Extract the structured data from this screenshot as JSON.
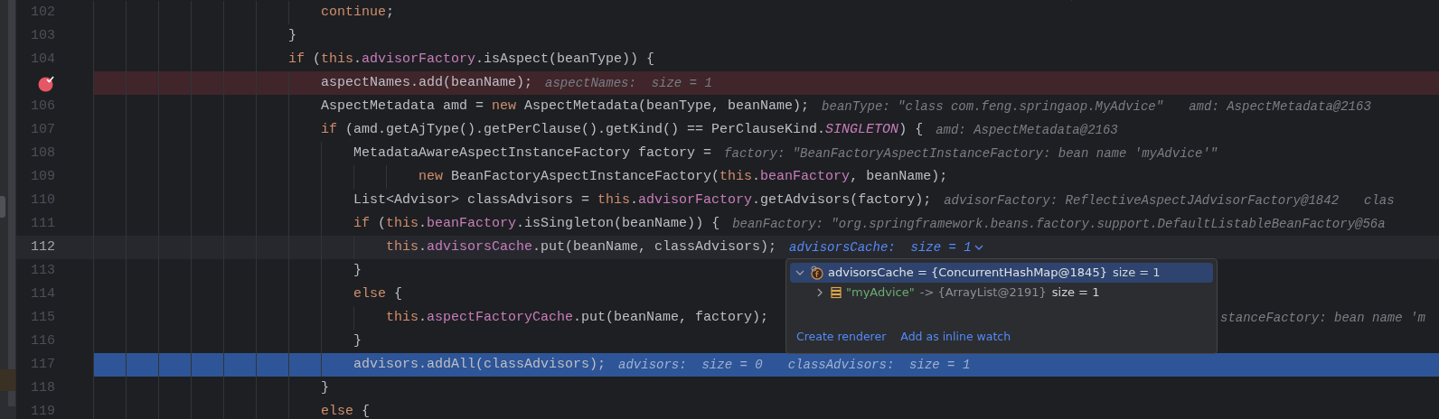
{
  "editor": {
    "lines": [
      {
        "number": "102",
        "breakpoint": false,
        "caret_line": false,
        "execution_point": false,
        "code": [
          {
            "kind": "keyword",
            "text": "                            continue"
          },
          {
            "kind": "plain",
            "text": ";"
          }
        ]
      },
      {
        "number": "103",
        "breakpoint": false,
        "caret_line": false,
        "execution_point": false,
        "code": [
          {
            "kind": "plain",
            "text": "                        }"
          }
        ]
      },
      {
        "number": "104",
        "breakpoint": false,
        "caret_line": false,
        "execution_point": false,
        "code": [
          {
            "kind": "keyword",
            "text": "                        if"
          },
          {
            "kind": "plain",
            "text": " ("
          },
          {
            "kind": "keyword",
            "text": "this"
          },
          {
            "kind": "plain",
            "text": "."
          },
          {
            "kind": "field",
            "text": "advisorFactory"
          },
          {
            "kind": "plain",
            "text": ".isAspect(beanType)) {"
          }
        ]
      },
      {
        "breakpoint": true,
        "caret_line": false,
        "execution_point": false,
        "code": [
          {
            "kind": "plain",
            "text": "                            aspectNames.add(beanName);"
          }
        ],
        "hints": [
          {
            "kind": "value",
            "text": "aspectNames:  size = 1"
          }
        ]
      },
      {
        "number": "106",
        "breakpoint": false,
        "caret_line": false,
        "execution_point": false,
        "code": [
          {
            "kind": "plain",
            "text": "                            AspectMetadata amd = "
          },
          {
            "kind": "keyword",
            "text": "new"
          },
          {
            "kind": "plain",
            "text": " AspectMetadata(beanType, beanName);"
          }
        ],
        "hints": [
          {
            "kind": "value",
            "text": "beanType: \"class com.feng.springaop.MyAdvice\""
          },
          {
            "kind": "value",
            "text": "amd: AspectMetadata@2163"
          }
        ]
      },
      {
        "number": "107",
        "breakpoint": false,
        "caret_line": false,
        "execution_point": false,
        "code": [
          {
            "kind": "keyword",
            "text": "                            if"
          },
          {
            "kind": "plain",
            "text": " (amd.getAjType().getPerClause().getKind() == PerClauseKind."
          },
          {
            "kind": "constant",
            "text": "SINGLETON"
          },
          {
            "kind": "plain",
            "text": ") {"
          }
        ],
        "hints": [
          {
            "kind": "value",
            "text": "amd: AspectMetadata@2163"
          }
        ]
      },
      {
        "number": "108",
        "breakpoint": false,
        "caret_line": false,
        "execution_point": false,
        "code": [
          {
            "kind": "plain",
            "text": "                                MetadataAwareAspectInstanceFactory factory ="
          }
        ],
        "hints": [
          {
            "kind": "value",
            "text": "factory: \"BeanFactoryAspectInstanceFactory: bean name 'myAdvice'\""
          }
        ]
      },
      {
        "number": "109",
        "breakpoint": false,
        "caret_line": false,
        "execution_point": false,
        "code": [
          {
            "kind": "keyword",
            "text": "                                        new"
          },
          {
            "kind": "plain",
            "text": " BeanFactoryAspectInstanceFactory("
          },
          {
            "kind": "keyword",
            "text": "this"
          },
          {
            "kind": "plain",
            "text": "."
          },
          {
            "kind": "field",
            "text": "beanFactory"
          },
          {
            "kind": "plain",
            "text": ", beanName);"
          }
        ]
      },
      {
        "number": "110",
        "breakpoint": false,
        "caret_line": false,
        "execution_point": false,
        "code": [
          {
            "kind": "plain",
            "text": "                                List<Advisor> classAdvisors = "
          },
          {
            "kind": "keyword",
            "text": "this"
          },
          {
            "kind": "plain",
            "text": "."
          },
          {
            "kind": "field",
            "text": "advisorFactory"
          },
          {
            "kind": "plain",
            "text": ".getAdvisors(factory);"
          }
        ],
        "hints": [
          {
            "kind": "value",
            "text": "advisorFactory: ReflectiveAspectJAdvisorFactory@1842"
          },
          {
            "kind": "value",
            "text": "clas"
          }
        ]
      },
      {
        "number": "111",
        "breakpoint": false,
        "caret_line": false,
        "execution_point": false,
        "code": [
          {
            "kind": "keyword",
            "text": "                                if"
          },
          {
            "kind": "plain",
            "text": " ("
          },
          {
            "kind": "keyword",
            "text": "this"
          },
          {
            "kind": "plain",
            "text": "."
          },
          {
            "kind": "field",
            "text": "beanFactory"
          },
          {
            "kind": "plain",
            "text": ".isSingleton(beanName)) {"
          }
        ],
        "hints": [
          {
            "kind": "value",
            "text": "beanFactory: \"org.springframework.beans.factory.support.DefaultListableBeanFactory@56a"
          }
        ]
      },
      {
        "number": "112",
        "breakpoint": false,
        "caret_line": true,
        "execution_point": false,
        "code": [
          {
            "kind": "keyword",
            "text": "                                    this"
          },
          {
            "kind": "plain",
            "text": "."
          },
          {
            "kind": "field",
            "text": "advisorsCache"
          },
          {
            "kind": "plain",
            "text": ".put(beanName, classAdvisors);"
          }
        ],
        "hints": [
          {
            "kind": "watch",
            "text": "advisorsCache:  size = 1"
          }
        ]
      },
      {
        "number": "113",
        "breakpoint": false,
        "caret_line": false,
        "execution_point": false,
        "code": [
          {
            "kind": "plain",
            "text": "                                }"
          }
        ]
      },
      {
        "number": "114",
        "breakpoint": false,
        "caret_line": false,
        "execution_point": false,
        "code": [
          {
            "kind": "keyword",
            "text": "                                else"
          },
          {
            "kind": "plain",
            "text": " {"
          }
        ]
      },
      {
        "number": "115",
        "breakpoint": false,
        "caret_line": false,
        "execution_point": false,
        "code": [
          {
            "kind": "keyword",
            "text": "                                    this"
          },
          {
            "kind": "plain",
            "text": "."
          },
          {
            "kind": "field",
            "text": "aspectFactoryCache"
          },
          {
            "kind": "plain",
            "text": ".put(beanName, factory);"
          }
        ],
        "hints": [
          {
            "kind": "behind_popup",
            "text": "stanceFactory: bean name 'm"
          }
        ]
      },
      {
        "number": "116",
        "breakpoint": false,
        "caret_line": false,
        "execution_point": false,
        "code": [
          {
            "kind": "plain",
            "text": "                                }"
          }
        ]
      },
      {
        "number": "117",
        "breakpoint": false,
        "caret_line": false,
        "execution_point": true,
        "code": [
          {
            "kind": "plain",
            "text": "                                advisors.addAll(classAdvisors);"
          }
        ],
        "hints": [
          {
            "kind": "value",
            "text": "advisors:  size = 0"
          },
          {
            "kind": "value",
            "text": "classAdvisors:  size = 1"
          }
        ]
      },
      {
        "number": "118",
        "breakpoint": false,
        "caret_line": false,
        "execution_point": false,
        "code": [
          {
            "kind": "plain",
            "text": "                            }"
          }
        ]
      },
      {
        "number": "119",
        "breakpoint": false,
        "caret_line": false,
        "execution_point": false,
        "code": [
          {
            "kind": "keyword",
            "text": "                            else"
          },
          {
            "kind": "plain",
            "text": " {"
          }
        ]
      }
    ]
  },
  "popup": {
    "tree": [
      {
        "kind": "map",
        "expanded": true,
        "selected": true,
        "parts": [
          {
            "kind": "name",
            "text": "advisorsCache = {ConcurrentHashMap@1845}"
          },
          {
            "kind": "plain",
            "text": "size = 1"
          }
        ],
        "children": [
          {
            "kind": "list",
            "expanded": false,
            "selected": false,
            "parts": [
              {
                "kind": "string",
                "text": "\"myAdvice\""
              },
              {
                "kind": "muted",
                "text": "-> {ArrayList@2191}"
              },
              {
                "kind": "plain",
                "text": "size = 1"
              }
            ]
          }
        ]
      }
    ],
    "links": [
      "Create renderer",
      "Add as inline watch"
    ]
  }
}
